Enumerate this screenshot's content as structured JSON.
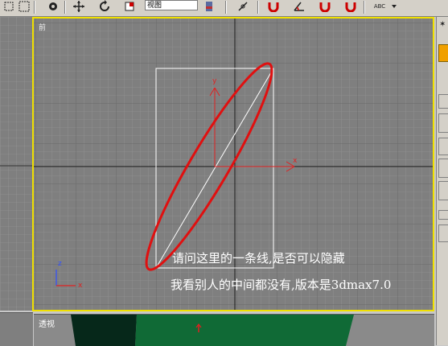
{
  "toolbar": {
    "view_dropdown_value": "视图",
    "buttons": [
      {
        "icon": "select-region-icon"
      },
      {
        "icon": "select-object-icon"
      },
      {
        "icon": "move-icon"
      },
      {
        "icon": "rotate-icon"
      },
      {
        "icon": "scale-icon"
      },
      {
        "icon": "pivot-icon"
      },
      {
        "icon": "link-icon"
      },
      {
        "icon": "snap-magnet-icon"
      },
      {
        "icon": "angle-snap-icon"
      },
      {
        "icon": "percent-snap-icon"
      },
      {
        "icon": "spinner-snap-icon"
      },
      {
        "icon": "spell-abc-icon"
      }
    ],
    "abc_label": "ABC"
  },
  "front_viewport": {
    "label": "前",
    "axis_labels": {
      "x": "x",
      "y": "y",
      "z": "z"
    },
    "annotation_line1": "请问这里的一条线,是否可以隐藏",
    "annotation_line2": "我看别人的中间都没有,版本是3dmax7.0",
    "highlight_color": "#e01010",
    "active_border_color": "#f0e000"
  },
  "persp_viewport": {
    "label": "透视"
  }
}
